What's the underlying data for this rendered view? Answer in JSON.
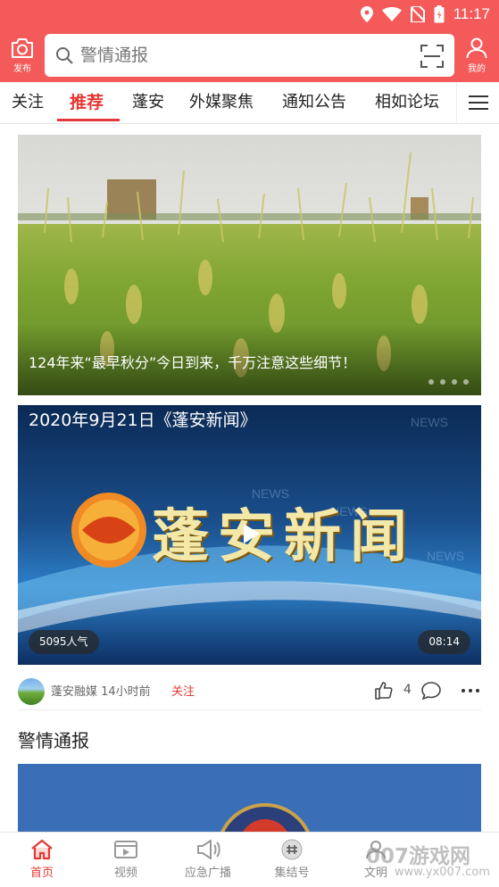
{
  "status_bar": {
    "time": "11:17"
  },
  "header": {
    "publish_label": "发布",
    "search_placeholder": "警情通报",
    "mine_label": "我的"
  },
  "tabs": [
    {
      "label": "关注",
      "active": false
    },
    {
      "label": "推荐",
      "active": true
    },
    {
      "label": "蓬安",
      "active": false
    },
    {
      "label": "外媒聚焦",
      "active": false
    },
    {
      "label": "通知公告",
      "active": false
    },
    {
      "label": "相如论坛",
      "active": false
    }
  ],
  "banner": {
    "caption": "124年来“最早秋分”今日到来，千万注意这些细节！",
    "dots": 4
  },
  "video_card": {
    "title": "2020年9月21日《蓬安新闻》",
    "logo_text": "蓬安新闻",
    "views": "5095人气",
    "duration": "08:14",
    "source": "蓬安融媒 14小时前",
    "follow": "关注",
    "likes": "4"
  },
  "section": {
    "title": "警情通报"
  },
  "bottom_nav": [
    {
      "label": "首页",
      "icon": "home-icon",
      "active": true
    },
    {
      "label": "视频",
      "icon": "video-icon",
      "active": false
    },
    {
      "label": "应急广播",
      "icon": "broadcast-icon",
      "active": false
    },
    {
      "label": "集结号",
      "icon": "rally-icon",
      "active": false
    },
    {
      "label": "文明",
      "icon": "civilization-icon",
      "active": false
    }
  ],
  "watermark": {
    "main": "007游戏网",
    "sub": "www.yx007.com"
  },
  "colors": {
    "brand": "#f45a5a",
    "active": "#e53935"
  }
}
